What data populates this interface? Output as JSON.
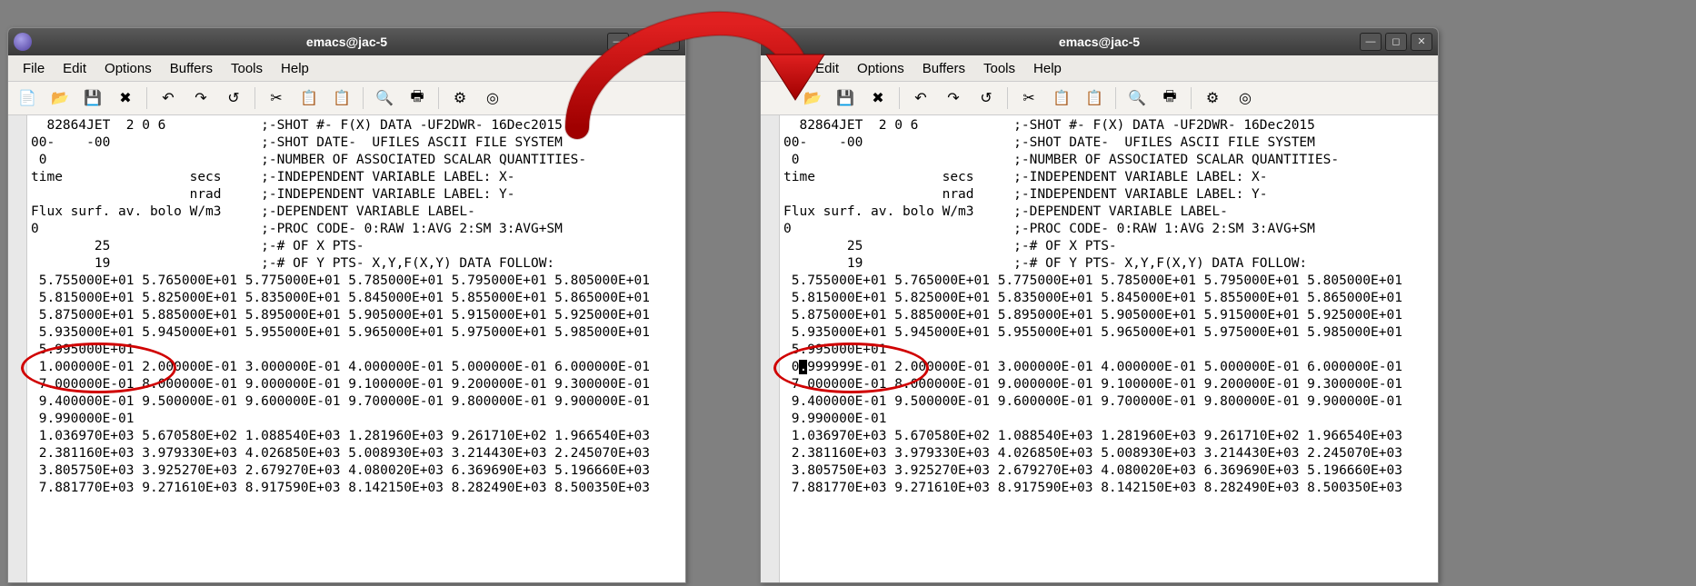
{
  "title": "emacs@jac-5",
  "menus": [
    "File",
    "Edit",
    "Options",
    "Buffers",
    "Tools",
    "Help"
  ],
  "tool_icons": [
    {
      "name": "new-file-icon",
      "glyph": "📄"
    },
    {
      "name": "open-file-icon",
      "glyph": "📂"
    },
    {
      "name": "save-icon",
      "glyph": "💾"
    },
    {
      "name": "close-icon",
      "glyph": "✖"
    },
    {
      "name": "sep"
    },
    {
      "name": "undo-icon",
      "glyph": "↶"
    },
    {
      "name": "redo-icon",
      "glyph": "↷"
    },
    {
      "name": "revert-icon",
      "glyph": "↺"
    },
    {
      "name": "sep"
    },
    {
      "name": "cut-icon",
      "glyph": "✂"
    },
    {
      "name": "copy-icon",
      "glyph": "📋"
    },
    {
      "name": "paste-icon",
      "glyph": "📋"
    },
    {
      "name": "sep"
    },
    {
      "name": "search-icon",
      "glyph": "🔍"
    },
    {
      "name": "print-icon",
      "glyph": "🖶"
    },
    {
      "name": "sep"
    },
    {
      "name": "prefs-icon",
      "glyph": "⚙"
    },
    {
      "name": "help-icon",
      "glyph": "◎"
    }
  ],
  "win_buttons": [
    {
      "name": "minimize-button",
      "glyph": "—"
    },
    {
      "name": "maximize-button",
      "glyph": "◻"
    },
    {
      "name": "close-window-button",
      "glyph": "✕"
    }
  ],
  "left_lines": [
    "  82864JET  2 0 6            ;-SHOT #- F(X) DATA -UF2DWR- 16Dec2015",
    "00-    -00                   ;-SHOT DATE-  UFILES ASCII FILE SYSTEM",
    " 0                           ;-NUMBER OF ASSOCIATED SCALAR QUANTITIES-",
    "time                secs     ;-INDEPENDENT VARIABLE LABEL: X-",
    "                    nrad     ;-INDEPENDENT VARIABLE LABEL: Y-",
    "Flux surf. av. bolo W/m3     ;-DEPENDENT VARIABLE LABEL-",
    "0                            ;-PROC CODE- 0:RAW 1:AVG 2:SM 3:AVG+SM",
    "        25                   ;-# OF X PTS-",
    "        19                   ;-# OF Y PTS- X,Y,F(X,Y) DATA FOLLOW:",
    " 5.755000E+01 5.765000E+01 5.775000E+01 5.785000E+01 5.795000E+01 5.805000E+01",
    " 5.815000E+01 5.825000E+01 5.835000E+01 5.845000E+01 5.855000E+01 5.865000E+01",
    " 5.875000E+01 5.885000E+01 5.895000E+01 5.905000E+01 5.915000E+01 5.925000E+01",
    " 5.935000E+01 5.945000E+01 5.955000E+01 5.965000E+01 5.975000E+01 5.985000E+01",
    " 5.995000E+01",
    " 1.000000E-01 2.000000E-01 3.000000E-01 4.000000E-01 5.000000E-01 6.000000E-01",
    " 7.000000E-01 8.000000E-01 9.000000E-01 9.100000E-01 9.200000E-01 9.300000E-01",
    " 9.400000E-01 9.500000E-01 9.600000E-01 9.700000E-01 9.800000E-01 9.900000E-01",
    " 9.990000E-01",
    " 1.036970E+03 5.670580E+02 1.088540E+03 1.281960E+03 9.261710E+02 1.966540E+03",
    " 2.381160E+03 3.979330E+03 4.026850E+03 5.008930E+03 3.214430E+03 2.245070E+03",
    " 3.805750E+03 3.925270E+03 2.679270E+03 4.080020E+03 6.369690E+03 5.196660E+03",
    " 7.881770E+03 9.271610E+03 8.917590E+03 8.142150E+03 8.282490E+03 8.500350E+03"
  ],
  "right_lines_pre": [
    "  82864JET  2 0 6            ;-SHOT #- F(X) DATA -UF2DWR- 16Dec2015",
    "00-    -00                   ;-SHOT DATE-  UFILES ASCII FILE SYSTEM",
    " 0                           ;-NUMBER OF ASSOCIATED SCALAR QUANTITIES-",
    "time                secs     ;-INDEPENDENT VARIABLE LABEL: X-",
    "                    nrad     ;-INDEPENDENT VARIABLE LABEL: Y-",
    "Flux surf. av. bolo W/m3     ;-DEPENDENT VARIABLE LABEL-",
    "0                            ;-PROC CODE- 0:RAW 1:AVG 2:SM 3:AVG+SM",
    "        25                   ;-# OF X PTS-",
    "        19                   ;-# OF Y PTS- X,Y,F(X,Y) DATA FOLLOW:",
    " 5.755000E+01 5.765000E+01 5.775000E+01 5.785000E+01 5.795000E+01 5.805000E+01",
    " 5.815000E+01 5.825000E+01 5.835000E+01 5.845000E+01 5.855000E+01 5.865000E+01",
    " 5.875000E+01 5.885000E+01 5.895000E+01 5.905000E+01 5.915000E+01 5.925000E+01",
    " 5.935000E+01 5.945000E+01 5.955000E+01 5.965000E+01 5.975000E+01 5.985000E+01",
    " 5.995000E+01"
  ],
  "right_cursor_line": {
    "before": " 0",
    "cursor": ".",
    "after": "999999E-01 2.000000E-01 3.000000E-01 4.000000E-01 5.000000E-01 6.000000E-01"
  },
  "right_lines_post": [
    " 7.000000E-01 8.000000E-01 9.000000E-01 9.100000E-01 9.200000E-01 9.300000E-01",
    " 9.400000E-01 9.500000E-01 9.600000E-01 9.700000E-01 9.800000E-01 9.900000E-01",
    " 9.990000E-01",
    " 1.036970E+03 5.670580E+02 1.088540E+03 1.281960E+03 9.261710E+02 1.966540E+03",
    " 2.381160E+03 3.979330E+03 4.026850E+03 5.008930E+03 3.214430E+03 2.245070E+03",
    " 3.805750E+03 3.925270E+03 2.679270E+03 4.080020E+03 6.369690E+03 5.196660E+03",
    " 7.881770E+03 9.271610E+03 8.917590E+03 8.142150E+03 8.282490E+03 8.500350E+03"
  ]
}
